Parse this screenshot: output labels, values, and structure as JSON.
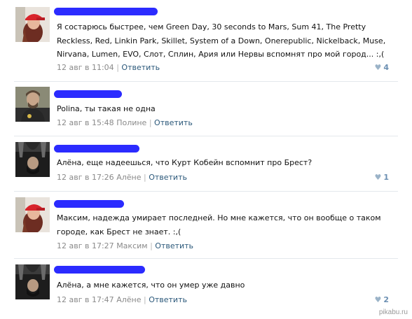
{
  "comments": [
    {
      "text": "Я состарюсь быстрее, чем Green Day, 30 seconds to Mars, Sum 41, The Pretty Reckless, Red, Linkin Park, Skillet, System of a Down, Onerepublic, Nickelback, Muse, Nirvana, Lumen, EVO, Слот, Сплин, Ария или Нервы вспомнят про мой город... :,(",
      "date": "12 авг в 11:04",
      "reply_to": "",
      "reply_label": "Ответить",
      "likes": "4",
      "avatar": "girl-red-cap"
    },
    {
      "text": "Polina, ты такая не одна",
      "date": "12 авг в 15:48",
      "reply_to": "Полине",
      "reply_label": "Ответить",
      "likes": "",
      "avatar": "bearded-man"
    },
    {
      "text": "Алёна, еще надеешься, что Курт Кобейн вспомнит про Брест?",
      "date": "12 авг в 17:26",
      "reply_to": "Алёне",
      "reply_label": "Ответить",
      "likes": "1",
      "avatar": "upside-down-man"
    },
    {
      "text": "Максим, надежда умирает последней. Но мне кажется, что он вообще о таком городе, как Брест не знает. :,(",
      "date": "12 авг в 17:27",
      "reply_to": "Максим",
      "reply_label": "Ответить",
      "likes": "",
      "avatar": "girl-red-cap"
    },
    {
      "text": "Алёна, а мне кажется, что он умер уже давно",
      "date": "12 авг в 17:47",
      "reply_to": "Алёне",
      "reply_label": "Ответить",
      "likes": "2",
      "avatar": "upside-down-man"
    }
  ],
  "watermark": "pikabu.ru",
  "colors": {
    "link": "#2b587a",
    "meta": "#8a8a8a",
    "like": "#6b8fb2",
    "scribble": "#2b2bff"
  }
}
